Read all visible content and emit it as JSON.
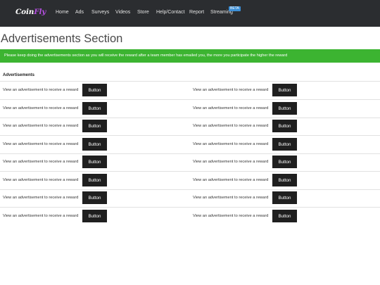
{
  "navbar": {
    "logo_text": "Coin",
    "logo_accent": "Fly",
    "links": [
      "Home",
      "Ads",
      "Surveys",
      "Videos",
      "Store",
      "Help/Contact",
      "Report",
      "Streaming"
    ],
    "beta_badge": "BETA"
  },
  "page": {
    "title": "Advertisements Section",
    "alert": "Please keep doing the advertisements section as you will receive the reward after a team member has emailed you, the more you participate the higher the reward"
  },
  "ads": {
    "heading": "Advertisements",
    "item_text": "View an advertisement to receive a reward",
    "button_label": "Button",
    "rows": 8,
    "columns": 2
  },
  "colors": {
    "navbar_bg": "#2b2d30",
    "logo_accent": "#b44fe0",
    "alert_bg": "#3cb431",
    "button_bg": "#1f1f1f",
    "beta_bg": "#3d8fd6"
  }
}
